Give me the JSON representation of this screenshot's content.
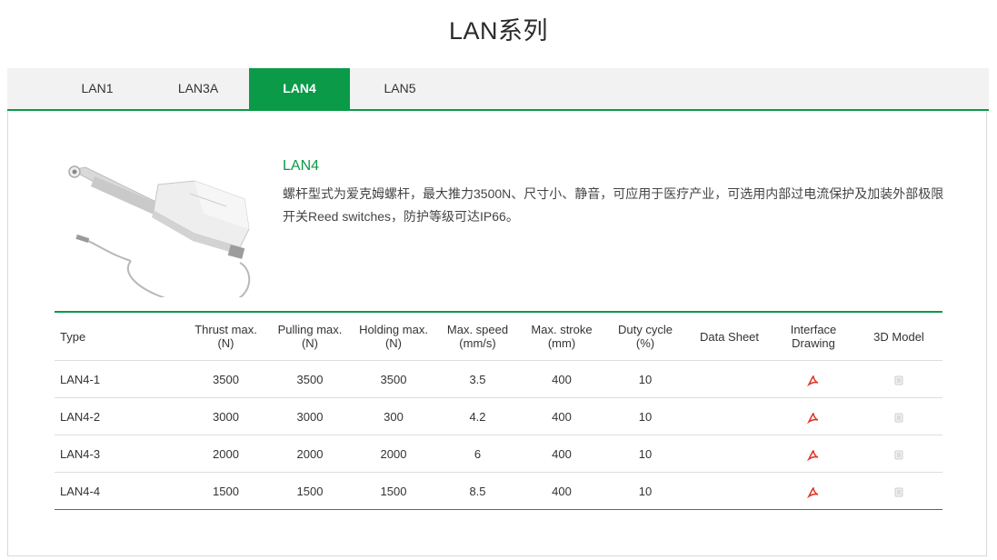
{
  "page": {
    "title": "LAN系列"
  },
  "tabs": [
    {
      "label": "LAN1",
      "active": false
    },
    {
      "label": "LAN3A",
      "active": false
    },
    {
      "label": "LAN4",
      "active": true
    },
    {
      "label": "LAN5",
      "active": false
    }
  ],
  "product": {
    "name": "LAN4",
    "description": "螺杆型式为爱克姆螺杆，最大推力3500N、尺寸小、静音，可应用于医疗产业，可选用内部过电流保护及加装外部极限开关Reed switches，防护等级可达IP66。",
    "image_icon": "linear-actuator-image"
  },
  "table": {
    "headers": {
      "type": "Type",
      "thrust": [
        "Thrust max.",
        "(N)"
      ],
      "pulling": [
        "Pulling max.",
        "(N)"
      ],
      "holding": [
        "Holding max.",
        "(N)"
      ],
      "speed": [
        "Max. speed",
        "(mm/s)"
      ],
      "stroke": [
        "Max. stroke",
        "(mm)"
      ],
      "duty": [
        "Duty cycle",
        "(%)"
      ],
      "datasheet": "Data Sheet",
      "interface": [
        "Interface",
        "Drawing"
      ],
      "model": "3D Model"
    },
    "rows": [
      {
        "type": "LAN4-1",
        "thrust": "3500",
        "pulling": "3500",
        "holding": "3500",
        "speed": "3.5",
        "stroke": "400",
        "duty": "10"
      },
      {
        "type": "LAN4-2",
        "thrust": "3000",
        "pulling": "3000",
        "holding": "300",
        "speed": "4.2",
        "stroke": "400",
        "duty": "10"
      },
      {
        "type": "LAN4-3",
        "thrust": "2000",
        "pulling": "2000",
        "holding": "2000",
        "speed": "6",
        "stroke": "400",
        "duty": "10"
      },
      {
        "type": "LAN4-4",
        "thrust": "1500",
        "pulling": "1500",
        "holding": "1500",
        "speed": "8.5",
        "stroke": "400",
        "duty": "10"
      }
    ],
    "icons": {
      "interface": "pdf-icon",
      "model": "3d-model-icon"
    }
  },
  "colors": {
    "accent": "#0a9a48",
    "pdf": "#e03a2e",
    "tab_bar": "#f2f2f2"
  }
}
